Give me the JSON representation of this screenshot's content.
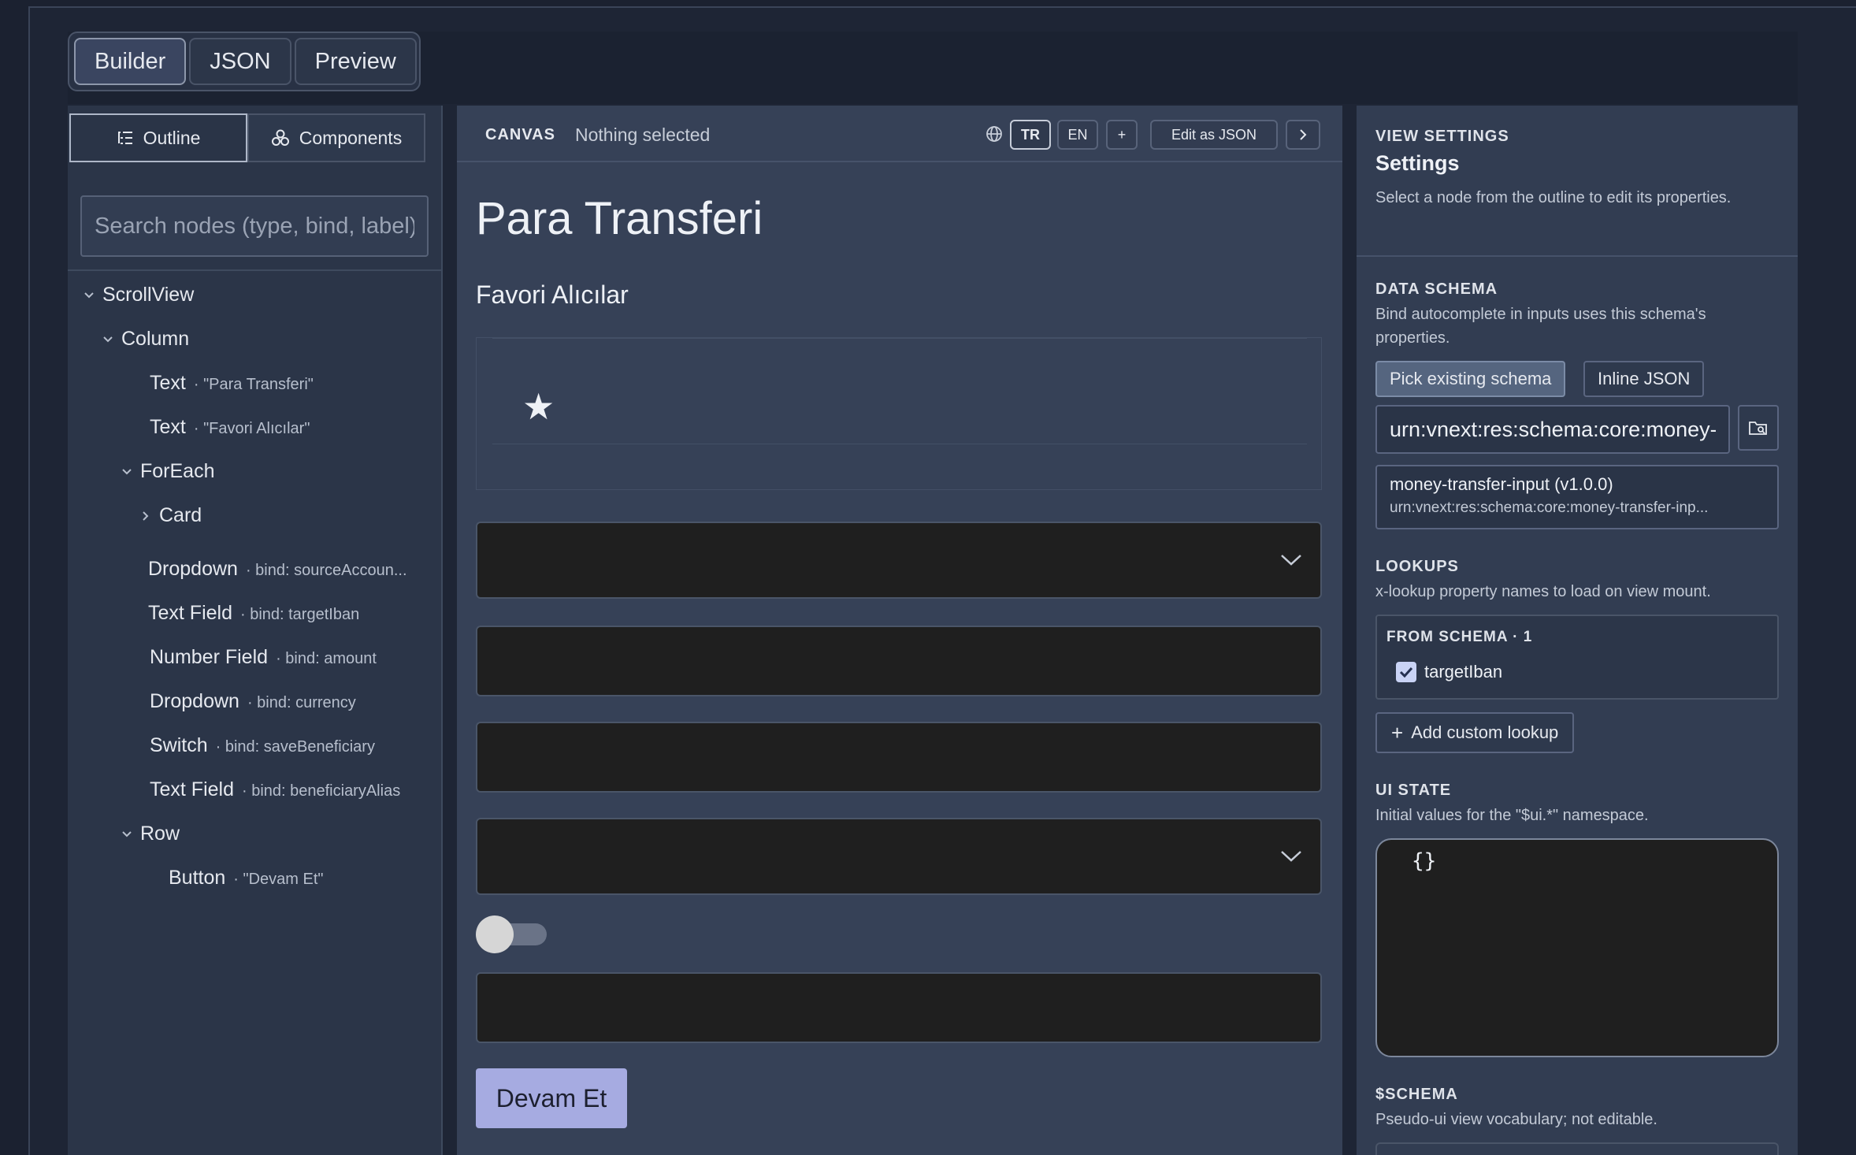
{
  "modes": [
    "Builder",
    "JSON",
    "Preview"
  ],
  "left": {
    "tabs": {
      "outline": "Outline",
      "components": "Components"
    },
    "search_placeholder": "Search nodes (type, bind, label)",
    "tree": [
      {
        "type": "ScrollView",
        "meta": ""
      },
      {
        "type": "Column",
        "meta": ""
      },
      {
        "type": "Text",
        "meta": "· \"Para Transferi\""
      },
      {
        "type": "Text",
        "meta": "· \"Favori Alıcılar\""
      },
      {
        "type": "ForEach",
        "meta": ""
      },
      {
        "type": "Card",
        "meta": ""
      },
      {
        "type": "Dropdown",
        "meta": "· bind: sourceAccoun..."
      },
      {
        "type": "Text Field",
        "meta": "· bind: targetIban"
      },
      {
        "type": "Number Field",
        "meta": "· bind: amount"
      },
      {
        "type": "Dropdown",
        "meta": "· bind: currency"
      },
      {
        "type": "Switch",
        "meta": "· bind: saveBeneficiary"
      },
      {
        "type": "Text Field",
        "meta": "· bind: beneficiaryAlias"
      },
      {
        "type": "Row",
        "meta": ""
      },
      {
        "type": "Button",
        "meta": "· \"Devam Et\""
      }
    ]
  },
  "canvas": {
    "label": "CANVAS",
    "selection": "Nothing selected",
    "langs": [
      "TR",
      "EN"
    ],
    "add_lang": "+",
    "edit_json": "Edit as JSON",
    "title": "Para Transferi",
    "subtitle": "Favori Alıcılar",
    "button": "Devam Et"
  },
  "right": {
    "view_label": "VIEW SETTINGS",
    "title": "Settings",
    "desc": "Select a node from the outline to edit its properties.",
    "schema_label": "DATA SCHEMA",
    "schema_desc": "Bind autocomplete in inputs uses this schema's properties.",
    "pick_existing": "Pick existing schema",
    "inline_json": "Inline JSON",
    "urn_value": "urn:vnext:res:schema:core:money-transfer-input",
    "schema_name": "money-transfer-input (v1.0.0)",
    "schema_urn": "urn:vnext:res:schema:core:money-transfer-inp...",
    "lookups_label": "LOOKUPS",
    "lookups_desc": "x-lookup property names to load on view mount.",
    "from_schema": "FROM SCHEMA · 1",
    "lookup_item": "targetIban",
    "add_lookup": "Add custom lookup",
    "ui_state_label": "UI STATE",
    "ui_state_desc": "Initial values for the \"$ui.*\" namespace.",
    "ui_state_value": "{}",
    "schema2_label": "$SCHEMA",
    "schema2_desc": "Pseudo-ui view vocabulary; not editable."
  },
  "colors": {
    "accent_button": "#a6abe1",
    "field_bg": "#1f1f1f",
    "checkbox": "#c9d3f5"
  }
}
